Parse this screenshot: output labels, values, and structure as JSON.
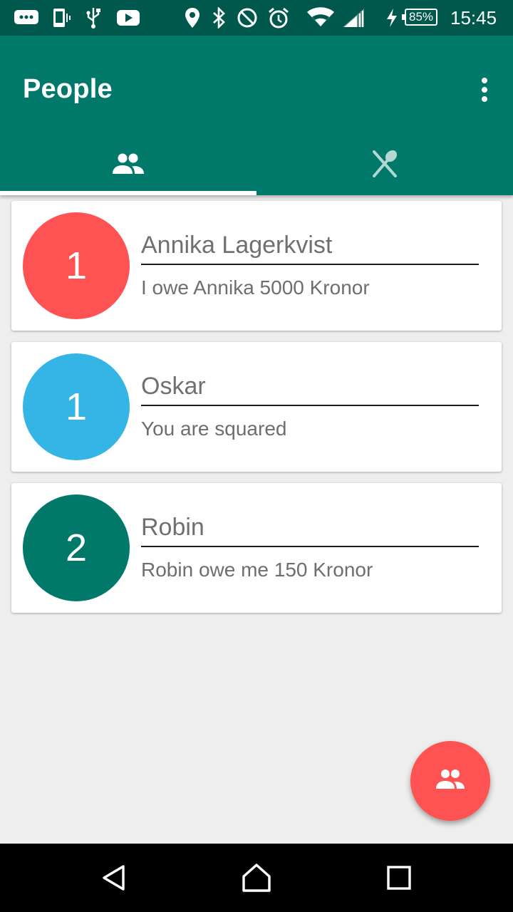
{
  "status_bar": {
    "battery": "85%",
    "time": "15:45",
    "icons": [
      "message-icon",
      "phone-vibrate-icon",
      "usb-icon",
      "youtube-icon",
      "location-icon",
      "bluetooth-icon",
      "do-not-disturb-icon",
      "alarm-icon",
      "wifi-icon",
      "signal-icon",
      "charging-icon"
    ]
  },
  "app_bar": {
    "title": "People",
    "menu_icon": "more-vert-icon",
    "tabs": [
      {
        "icon": "people-icon",
        "selected": true
      },
      {
        "icon": "restaurant-icon",
        "selected": false
      }
    ]
  },
  "people": [
    {
      "avatar_text": "1",
      "avatar_color": "#ff5252",
      "name": "Annika Lagerkvist",
      "status": "I owe Annika 5000 Kronor"
    },
    {
      "avatar_text": "1",
      "avatar_color": "#35b5e5",
      "name": "Oskar",
      "status": "You are squared"
    },
    {
      "avatar_text": "2",
      "avatar_color": "#00796b",
      "name": "Robin",
      "status": "Robin owe me 150 Kronor"
    }
  ],
  "fab": {
    "icon": "group-add-icon",
    "color": "#ff5252"
  },
  "nav_bar": {
    "buttons": [
      "back-icon",
      "home-icon",
      "recents-icon"
    ]
  },
  "colors": {
    "primary": "#00796b",
    "primary_dark": "#00574b",
    "accent": "#ff5252",
    "background": "#eeeeee"
  }
}
